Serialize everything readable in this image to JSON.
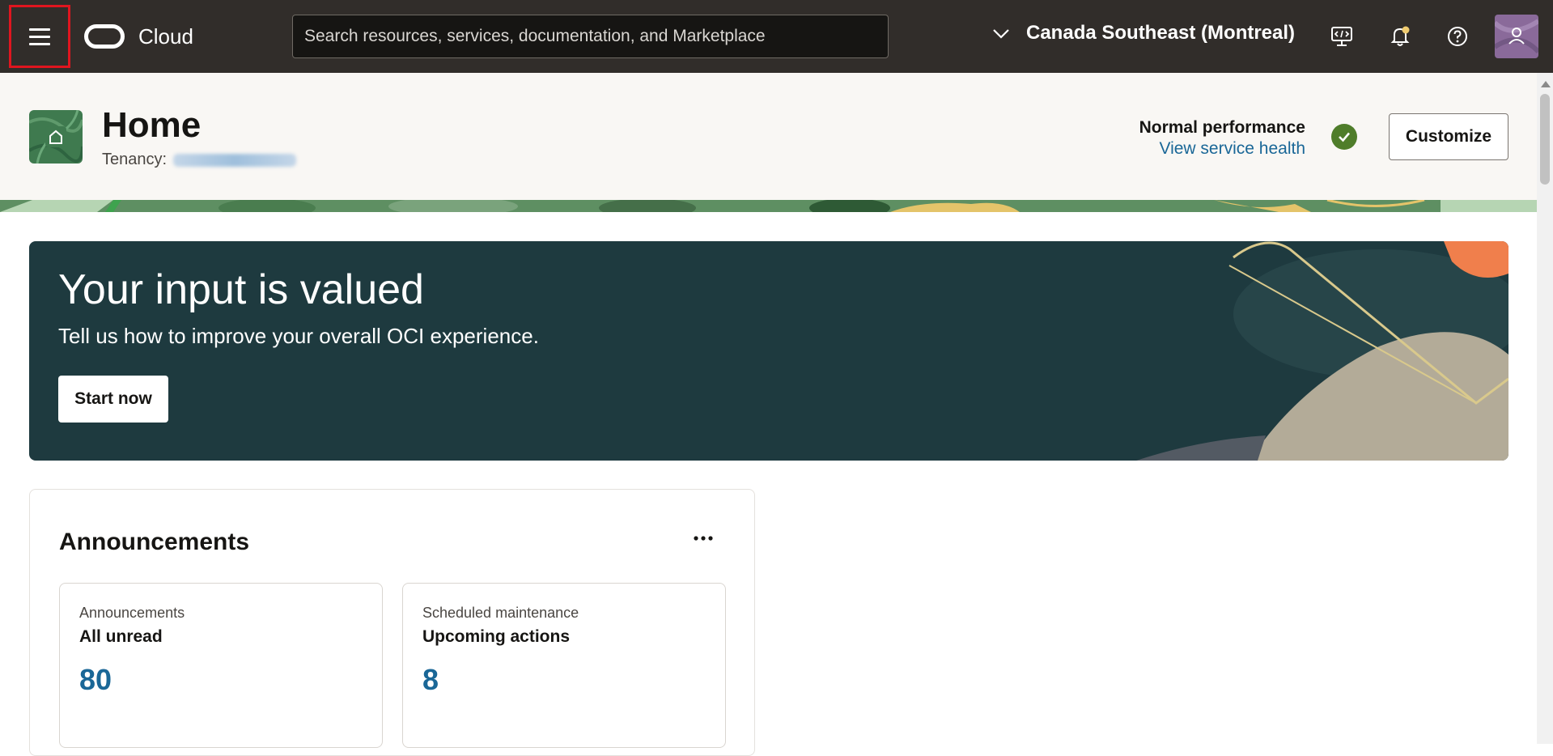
{
  "topbar": {
    "brand": "Cloud",
    "search_placeholder": "Search resources, services, documentation, and Marketplace",
    "region": "Canada Southeast (Montreal)"
  },
  "header": {
    "title": "Home",
    "tenancy_label": "Tenancy:",
    "performance_status": "Normal performance",
    "service_health_link": "View service health",
    "customize_label": "Customize"
  },
  "banner": {
    "title": "Your input is valued",
    "subtitle": "Tell us how to improve your overall OCI experience.",
    "cta_label": "Start now"
  },
  "announcements": {
    "title": "Announcements",
    "cards": [
      {
        "subtitle": "Announcements",
        "heading": "All unread",
        "count": "80"
      },
      {
        "subtitle": "Scheduled maintenance",
        "heading": "Upcoming actions",
        "count": "8"
      }
    ]
  },
  "colors": {
    "topbar_bg": "#312d2a",
    "banner_bg": "#1e3a3f",
    "link": "#1a6797",
    "status_ok": "#4f7d2a",
    "menu_highlight": "#e0151f"
  }
}
